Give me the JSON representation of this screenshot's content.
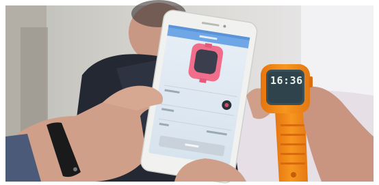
{
  "scene": {
    "colors": {
      "background_left": "#c9c9c6",
      "background_right": "#e8e6ea",
      "jacket": "#232833",
      "skin": "#cfa08c",
      "phone_body": "#f1f1ef",
      "phone_screen": "#dfeaf4",
      "app_header": "#6ea6e6",
      "pink_watch": "#f06e8c",
      "orange_watch": "#f28a1a",
      "watch_screen": "#3a4f58",
      "wristband": "#1a1a1a"
    },
    "icons": [
      "smartphone-icon",
      "smartwatch-icon"
    ]
  },
  "watch": {
    "time_display": "16:36"
  }
}
